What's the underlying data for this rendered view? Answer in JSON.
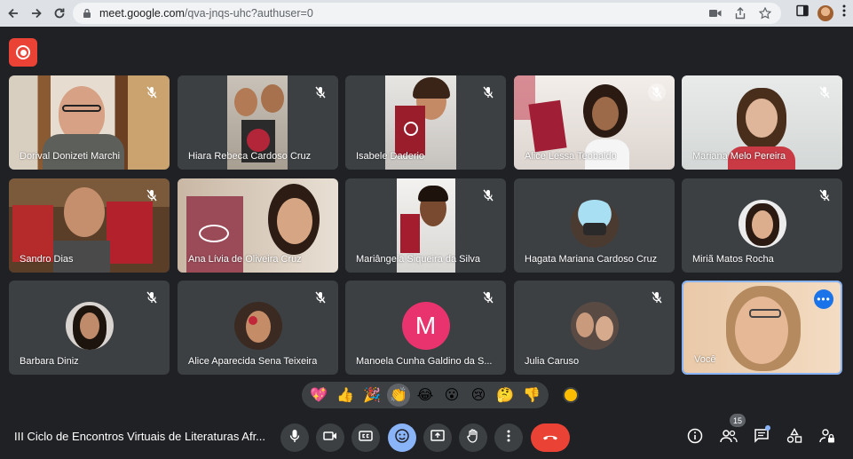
{
  "browser": {
    "url_host": "meet.google.com",
    "url_path": "/qva-jnqs-uhc?authuser=0"
  },
  "tiles": [
    {
      "name": "Dorival Donizeti Marchi",
      "muted": true
    },
    {
      "name": "Hiara Rebeca Cardoso Cruz",
      "muted": true
    },
    {
      "name": "Isabele Daderio",
      "muted": true
    },
    {
      "name": "Alice Lessa Teobaldo",
      "muted": true
    },
    {
      "name": "Mariana Melo Pereira",
      "muted": true
    },
    {
      "name": "Sandro Dias",
      "muted": true
    },
    {
      "name": "Ana Lívia de Oliveira Cruz",
      "muted": false
    },
    {
      "name": "Mariângela Siqueira da Silva",
      "muted": true
    },
    {
      "name": "Hagata Mariana Cardoso Cruz",
      "muted": false
    },
    {
      "name": "Miriã Matos Rocha",
      "muted": true
    },
    {
      "name": "Barbara Diniz",
      "muted": true
    },
    {
      "name": "Alice Aparecida Sena Teixeira",
      "muted": true
    },
    {
      "name": "Manoela Cunha Galdino da S...",
      "muted": true,
      "initial": "M"
    },
    {
      "name": "Julia Caruso",
      "muted": true
    },
    {
      "name": "Você",
      "muted": false
    }
  ],
  "reactions": [
    "💖",
    "👍",
    "🎉",
    "👏",
    "😂",
    "😮",
    "😢",
    "🤔",
    "👎"
  ],
  "meeting": {
    "title": "III Ciclo de Encontros Virtuais de Literaturas Afr...",
    "participant_count": "15"
  },
  "colors": {
    "background": "#202124",
    "tile": "#3c4043",
    "accent": "#8ab4f8",
    "end_call": "#ea4335",
    "avatar_m": "#e8336e"
  }
}
